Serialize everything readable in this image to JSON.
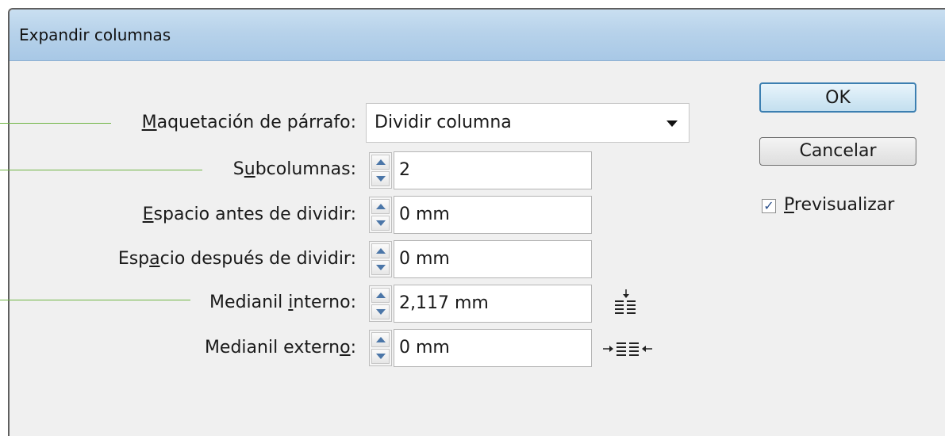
{
  "window": {
    "title": "Expandir columnas"
  },
  "fields": {
    "paragraph_layout": {
      "label_pre": "",
      "label_key": "M",
      "label_post": "aquetación de párrafo:",
      "value": "Dividir columna"
    },
    "subcolumns": {
      "label_pre": "S",
      "label_key": "u",
      "label_post": "bcolumnas:",
      "value": "2"
    },
    "space_before": {
      "label_pre": "",
      "label_key": "E",
      "label_post": "spacio antes de dividir:",
      "value": "0 mm"
    },
    "space_after": {
      "label_pre": "Esp",
      "label_key": "a",
      "label_post": "cio después de dividir:",
      "value": "0 mm"
    },
    "inner_gutter": {
      "label_pre": "Medianil ",
      "label_key": "i",
      "label_post": "nterno:",
      "value": "2,117 mm"
    },
    "outer_gutter": {
      "label_pre": "Medianil extern",
      "label_key": "o",
      "label_post": ":",
      "value": "0 mm"
    }
  },
  "buttons": {
    "ok": "OK",
    "cancel": "Cancelar"
  },
  "preview": {
    "label_key": "P",
    "label_post": "revisualizar",
    "checked": true
  },
  "icons": {
    "inner_gutter": "inner-gutter-icon",
    "outer_gutter": "outer-gutter-icon",
    "spinner_up": "spin-up-icon",
    "spinner_down": "spin-down-icon",
    "dropdown": "chevron-down-icon"
  },
  "colors": {
    "guide_line": "#6fb544",
    "titlebar": "#b7d2ea",
    "dialog_bg": "#f0f0f0",
    "default_button_border": "#3c7fb1"
  }
}
